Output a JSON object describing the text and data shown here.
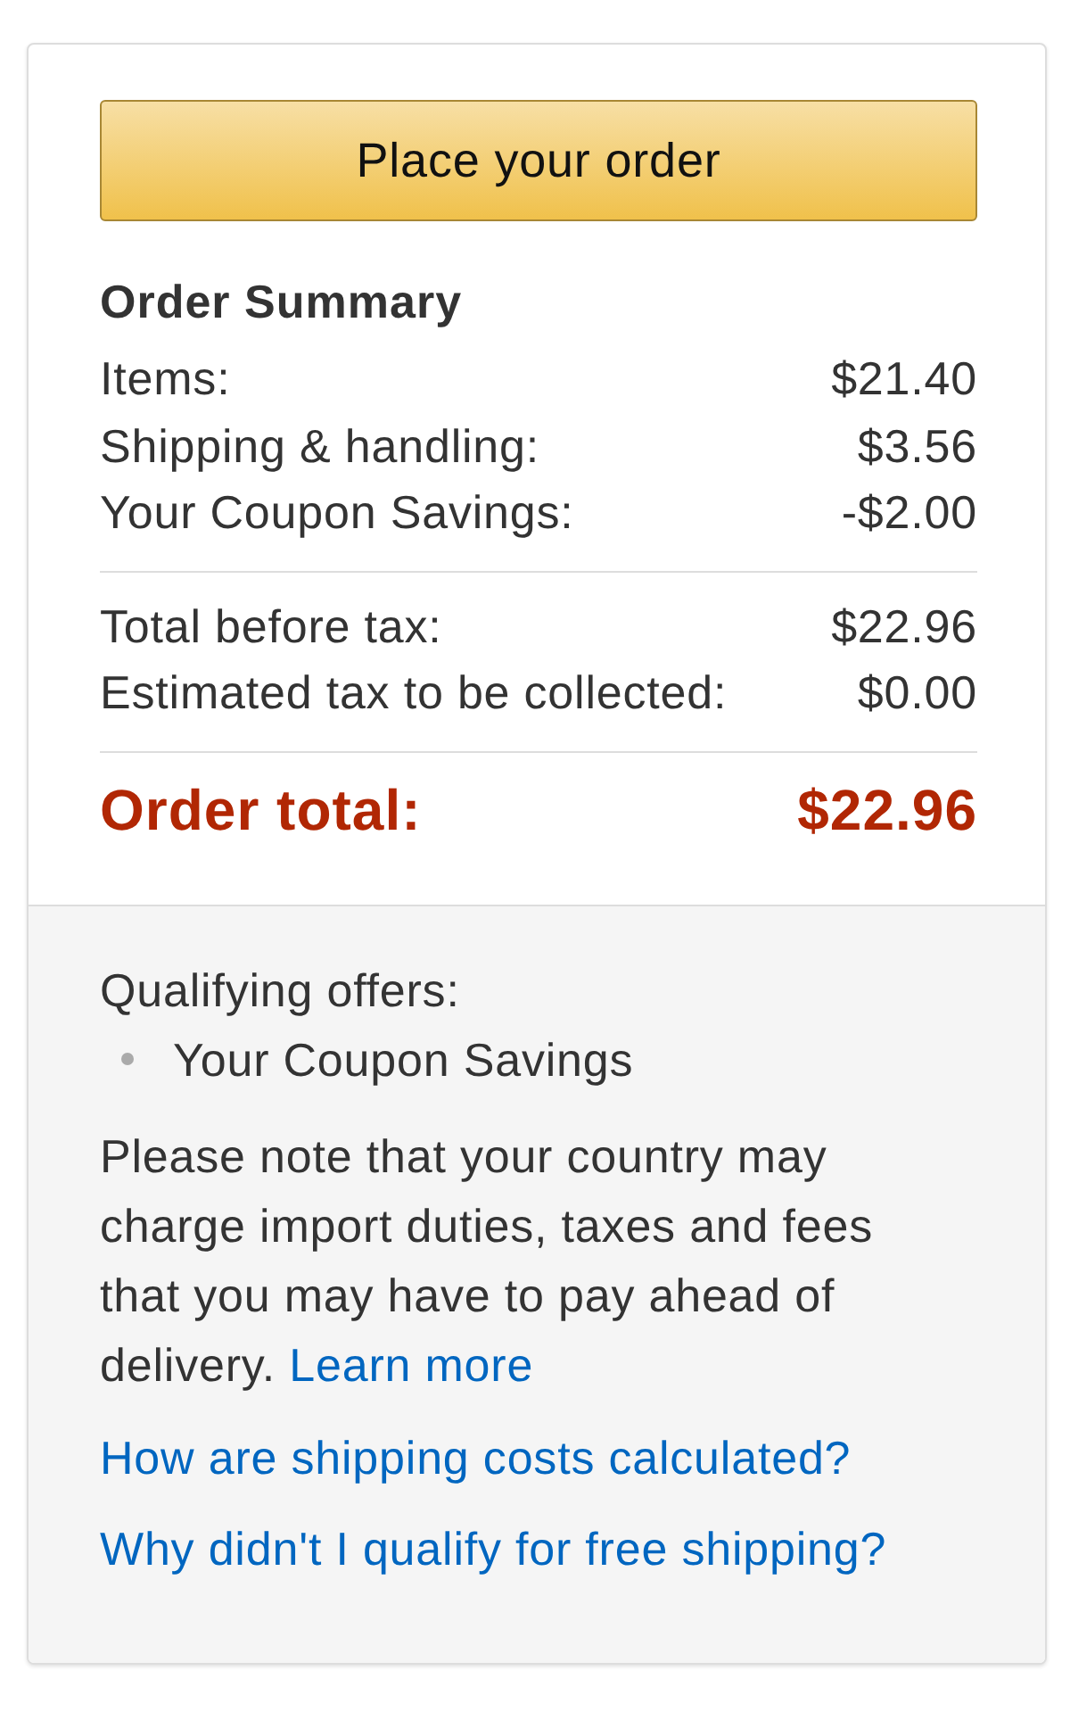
{
  "place_order_button": {
    "label": "Place your order"
  },
  "order_summary": {
    "title": "Order Summary",
    "line_items": [
      {
        "label": "Items:",
        "amount": "$21.40"
      },
      {
        "label": "Shipping & handling:",
        "amount": "$3.56"
      },
      {
        "label": "Your Coupon Savings:",
        "amount": "-$2.00"
      }
    ],
    "subtotals": [
      {
        "label": "Total before tax:",
        "amount": "$22.96"
      },
      {
        "label": "Estimated tax to be collected:",
        "amount": "$0.00"
      }
    ],
    "order_total": {
      "label": "Order total:",
      "amount": "$22.96"
    }
  },
  "offers": {
    "heading": "Qualifying offers:",
    "items": [
      "Your Coupon Savings"
    ]
  },
  "notice": {
    "text": "Please note that your country may charge import duties, taxes and fees that you may have to pay ahead of delivery.",
    "link": "Learn more"
  },
  "help_links": [
    "How are shipping costs calculated?",
    "Why didn't I qualify for free shipping?"
  ]
}
